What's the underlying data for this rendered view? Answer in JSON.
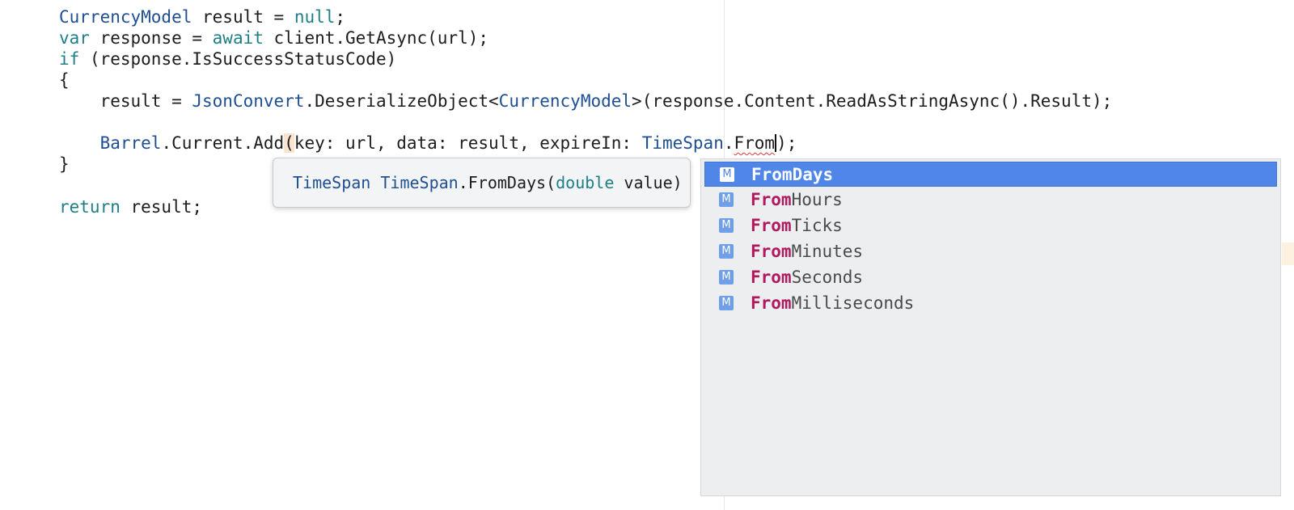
{
  "code": {
    "line1": {
      "type": "CurrencyModel",
      "mid": " result = ",
      "kw": "null",
      "end": ";"
    },
    "line2": {
      "kw1": "var",
      "mid": " response = ",
      "kw2": "await",
      "end": " client.GetAsync(url);"
    },
    "line3": {
      "kw": "if",
      "end": " (response.IsSuccessStatusCode)"
    },
    "line4": {
      "text": "{"
    },
    "line5": {
      "indent": "    result = ",
      "type1": "JsonConvert",
      "mid": ".DeserializeObject<",
      "type2": "CurrencyModel",
      "end": ">(response.Content.ReadAsStringAsync().Result);"
    },
    "line7": {
      "indent": "    ",
      "type1": "Barrel",
      "mid1": ".Current.Add",
      "paren": "(",
      "mid2": "key: url, data: result, expireIn: ",
      "type2": "TimeSpan",
      "dot": ".",
      "typed": "From",
      "end": ");"
    },
    "line8": {
      "text": "}"
    },
    "line10": {
      "kw": "return",
      "end": " result;"
    }
  },
  "tooltip": {
    "return_type": "TimeSpan",
    "owner_type": "TimeSpan",
    "method": ".FromDays(",
    "param_kw": "double",
    "param_rest": " value)"
  },
  "completion": {
    "icon_letter": "M",
    "match": "From",
    "selected_index": 0,
    "items": [
      {
        "match": "From",
        "rest": "Days"
      },
      {
        "match": "From",
        "rest": "Hours"
      },
      {
        "match": "From",
        "rest": "Ticks"
      },
      {
        "match": "From",
        "rest": "Minutes"
      },
      {
        "match": "From",
        "rest": "Seconds"
      },
      {
        "match": "From",
        "rest": "Milliseconds"
      }
    ]
  },
  "colors": {
    "keyword": "#1e7f86",
    "type": "#1f4f91",
    "match_highlight": "#b0195f",
    "selection": "#4f86e8"
  }
}
